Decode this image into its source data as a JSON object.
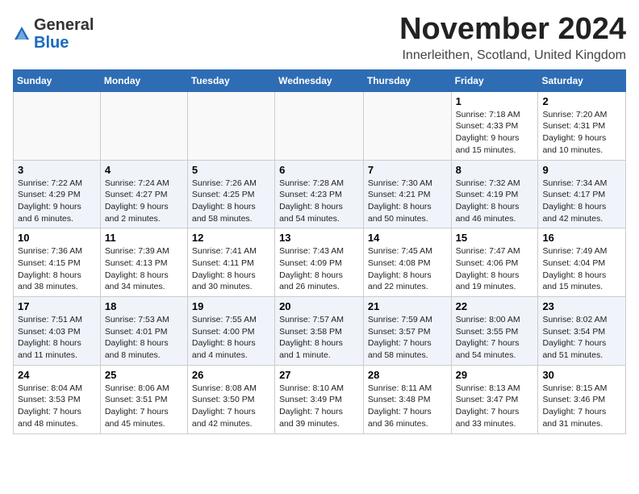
{
  "logo": {
    "general": "General",
    "blue": "Blue"
  },
  "title": "November 2024",
  "location": "Innerleithen, Scotland, United Kingdom",
  "days_of_week": [
    "Sunday",
    "Monday",
    "Tuesday",
    "Wednesday",
    "Thursday",
    "Friday",
    "Saturday"
  ],
  "weeks": [
    [
      {
        "day": "",
        "info": ""
      },
      {
        "day": "",
        "info": ""
      },
      {
        "day": "",
        "info": ""
      },
      {
        "day": "",
        "info": ""
      },
      {
        "day": "",
        "info": ""
      },
      {
        "day": "1",
        "info": "Sunrise: 7:18 AM\nSunset: 4:33 PM\nDaylight: 9 hours and 15 minutes."
      },
      {
        "day": "2",
        "info": "Sunrise: 7:20 AM\nSunset: 4:31 PM\nDaylight: 9 hours and 10 minutes."
      }
    ],
    [
      {
        "day": "3",
        "info": "Sunrise: 7:22 AM\nSunset: 4:29 PM\nDaylight: 9 hours and 6 minutes."
      },
      {
        "day": "4",
        "info": "Sunrise: 7:24 AM\nSunset: 4:27 PM\nDaylight: 9 hours and 2 minutes."
      },
      {
        "day": "5",
        "info": "Sunrise: 7:26 AM\nSunset: 4:25 PM\nDaylight: 8 hours and 58 minutes."
      },
      {
        "day": "6",
        "info": "Sunrise: 7:28 AM\nSunset: 4:23 PM\nDaylight: 8 hours and 54 minutes."
      },
      {
        "day": "7",
        "info": "Sunrise: 7:30 AM\nSunset: 4:21 PM\nDaylight: 8 hours and 50 minutes."
      },
      {
        "day": "8",
        "info": "Sunrise: 7:32 AM\nSunset: 4:19 PM\nDaylight: 8 hours and 46 minutes."
      },
      {
        "day": "9",
        "info": "Sunrise: 7:34 AM\nSunset: 4:17 PM\nDaylight: 8 hours and 42 minutes."
      }
    ],
    [
      {
        "day": "10",
        "info": "Sunrise: 7:36 AM\nSunset: 4:15 PM\nDaylight: 8 hours and 38 minutes."
      },
      {
        "day": "11",
        "info": "Sunrise: 7:39 AM\nSunset: 4:13 PM\nDaylight: 8 hours and 34 minutes."
      },
      {
        "day": "12",
        "info": "Sunrise: 7:41 AM\nSunset: 4:11 PM\nDaylight: 8 hours and 30 minutes."
      },
      {
        "day": "13",
        "info": "Sunrise: 7:43 AM\nSunset: 4:09 PM\nDaylight: 8 hours and 26 minutes."
      },
      {
        "day": "14",
        "info": "Sunrise: 7:45 AM\nSunset: 4:08 PM\nDaylight: 8 hours and 22 minutes."
      },
      {
        "day": "15",
        "info": "Sunrise: 7:47 AM\nSunset: 4:06 PM\nDaylight: 8 hours and 19 minutes."
      },
      {
        "day": "16",
        "info": "Sunrise: 7:49 AM\nSunset: 4:04 PM\nDaylight: 8 hours and 15 minutes."
      }
    ],
    [
      {
        "day": "17",
        "info": "Sunrise: 7:51 AM\nSunset: 4:03 PM\nDaylight: 8 hours and 11 minutes."
      },
      {
        "day": "18",
        "info": "Sunrise: 7:53 AM\nSunset: 4:01 PM\nDaylight: 8 hours and 8 minutes."
      },
      {
        "day": "19",
        "info": "Sunrise: 7:55 AM\nSunset: 4:00 PM\nDaylight: 8 hours and 4 minutes."
      },
      {
        "day": "20",
        "info": "Sunrise: 7:57 AM\nSunset: 3:58 PM\nDaylight: 8 hours and 1 minute."
      },
      {
        "day": "21",
        "info": "Sunrise: 7:59 AM\nSunset: 3:57 PM\nDaylight: 7 hours and 58 minutes."
      },
      {
        "day": "22",
        "info": "Sunrise: 8:00 AM\nSunset: 3:55 PM\nDaylight: 7 hours and 54 minutes."
      },
      {
        "day": "23",
        "info": "Sunrise: 8:02 AM\nSunset: 3:54 PM\nDaylight: 7 hours and 51 minutes."
      }
    ],
    [
      {
        "day": "24",
        "info": "Sunrise: 8:04 AM\nSunset: 3:53 PM\nDaylight: 7 hours and 48 minutes."
      },
      {
        "day": "25",
        "info": "Sunrise: 8:06 AM\nSunset: 3:51 PM\nDaylight: 7 hours and 45 minutes."
      },
      {
        "day": "26",
        "info": "Sunrise: 8:08 AM\nSunset: 3:50 PM\nDaylight: 7 hours and 42 minutes."
      },
      {
        "day": "27",
        "info": "Sunrise: 8:10 AM\nSunset: 3:49 PM\nDaylight: 7 hours and 39 minutes."
      },
      {
        "day": "28",
        "info": "Sunrise: 8:11 AM\nSunset: 3:48 PM\nDaylight: 7 hours and 36 minutes."
      },
      {
        "day": "29",
        "info": "Sunrise: 8:13 AM\nSunset: 3:47 PM\nDaylight: 7 hours and 33 minutes."
      },
      {
        "day": "30",
        "info": "Sunrise: 8:15 AM\nSunset: 3:46 PM\nDaylight: 7 hours and 31 minutes."
      }
    ]
  ]
}
